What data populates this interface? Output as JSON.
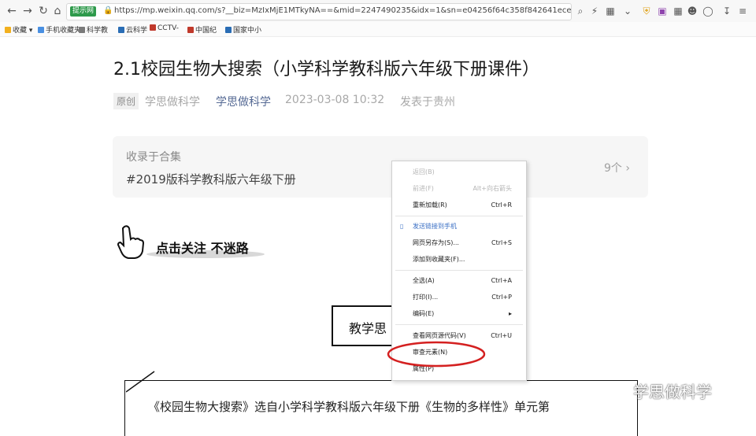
{
  "browser": {
    "badge": "提示网",
    "url": "https://mp.weixin.qq.com/s?__biz=MzIxMjE1MTkyNA==&mid=2247490235&idx=1&sn=e04256f64c358f842641ece95b1b43c8&chksm=974b"
  },
  "bookmarks": [
    {
      "label": "收藏",
      "color": "#f2b01e"
    },
    {
      "label": "手机收藏夹",
      "color": "#4a90e2"
    },
    {
      "label": "科学教",
      "color": "#7a7a7a"
    },
    {
      "label": "云科学",
      "color": "#2a6db5"
    },
    {
      "label": "CCTV-",
      "color": "#c0392b"
    },
    {
      "label": "中国纪",
      "color": "#c0392b"
    },
    {
      "label": "国家中小",
      "color": "#2a6db5"
    }
  ],
  "article": {
    "title": "2.1校园生物大搜索（小学科学教科版六年级下册课件）",
    "original_tag": "原创",
    "author": "学思做科学",
    "account": "学思做科学",
    "date": "2023-03-08 10:32",
    "location": "发表于贵州",
    "album_label": "收录于合集",
    "album_name": "#2019版科学教科版六年级下册",
    "album_count": "9个",
    "follow_text": "点击关注 不迷路",
    "box_title": "教学思",
    "paragraph": "《校园生物大搜索》选自小学科学教科版六年级下册《生物的多样性》单元第"
  },
  "watermark": "学思做科学",
  "context_menu": {
    "items": [
      {
        "label": "返回(B)",
        "shortcut": "",
        "state": "disabled"
      },
      {
        "label": "前进(F)",
        "shortcut": "Alt+向右箭头",
        "state": "disabled"
      },
      {
        "label": "重新加载(R)",
        "shortcut": "Ctrl+R",
        "state": "normal"
      },
      {
        "label": "发送链接到手机",
        "shortcut": "",
        "state": "blue"
      },
      {
        "label": "网页另存为(S)...",
        "shortcut": "Ctrl+S",
        "state": "normal"
      },
      {
        "label": "添加到收藏夹(F)...",
        "shortcut": "",
        "state": "normal"
      },
      {
        "label": "全选(A)",
        "shortcut": "Ctrl+A",
        "state": "normal"
      },
      {
        "label": "打印(I)...",
        "shortcut": "Ctrl+P",
        "state": "normal"
      },
      {
        "label": "编码(E)",
        "shortcut": "",
        "state": "normal"
      },
      {
        "label": "查看网页源代码(V)",
        "shortcut": "Ctrl+U",
        "state": "normal"
      },
      {
        "label": "审查元素(N)",
        "shortcut": "",
        "state": "normal"
      },
      {
        "label": "属性(P)",
        "shortcut": "",
        "state": "normal"
      }
    ],
    "submenu_arrow": "▸",
    "highlight_color": "#d42020"
  }
}
